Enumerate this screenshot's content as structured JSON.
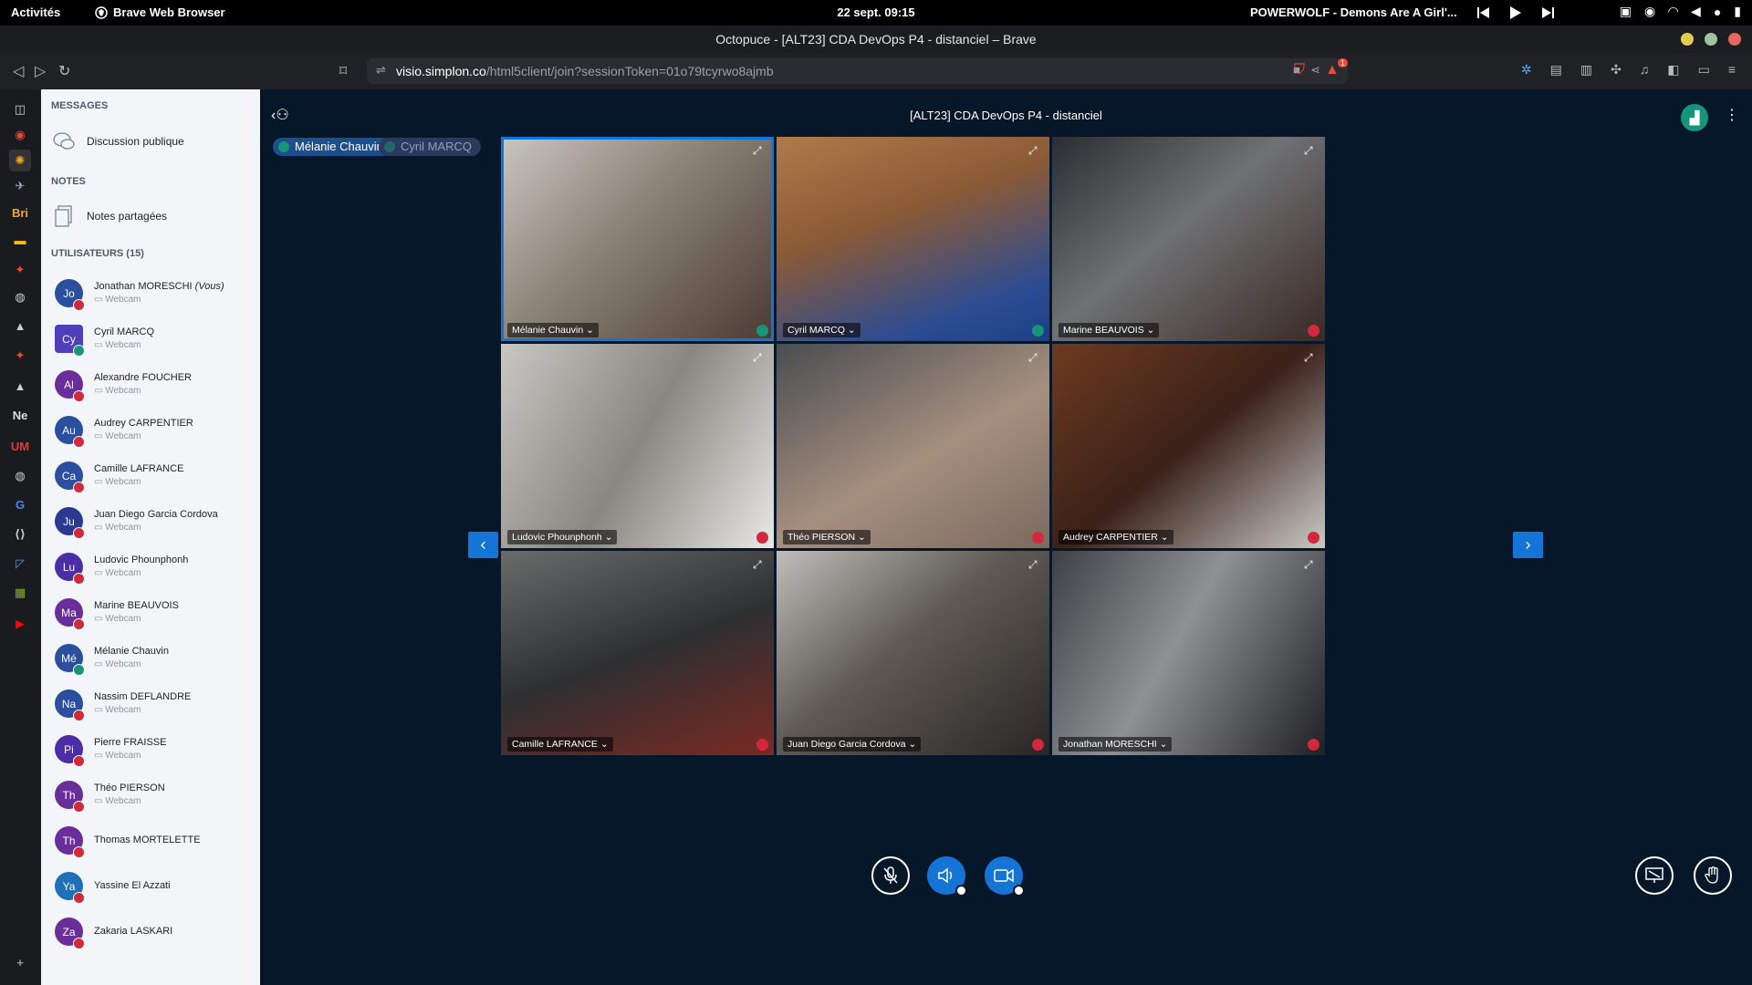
{
  "topbar": {
    "activities": "Activités",
    "app_name": "Brave Web Browser",
    "clock": "22 sept.  09:15",
    "now_playing": "POWERWOLF - Demons Are A Girl'..."
  },
  "browser": {
    "window_title": "Octopuce - [ALT23] CDA DevOps P4 - distanciel – Brave",
    "url_host": "visio.simplon.co",
    "url_path": "/html5client/join?sessionToken=01o79tcyrwo8ajmb",
    "shield_badge": "1"
  },
  "sidebar_brave": {
    "labels": [
      "Bri",
      "Ne",
      "UM"
    ]
  },
  "panel": {
    "messages_title": "MESSAGES",
    "public_chat": "Discussion publique",
    "notes_title": "NOTES",
    "shared_notes": "Notes partagées",
    "users_title": "UTILISATEURS (15)",
    "users": [
      {
        "initials": "Jo",
        "name": "Jonathan MORESCHI",
        "you": "(Vous)",
        "status": "Webcam",
        "color": "#2b4f9e",
        "mic": "muted"
      },
      {
        "initials": "Cy",
        "name": "Cyril MARCQ",
        "you": "",
        "status": "Webcam",
        "color": "#4f3fb8",
        "mic": "talking"
      },
      {
        "initials": "Al",
        "name": "Alexandre FOUCHER",
        "you": "",
        "status": "Webcam",
        "color": "#6a2e9a",
        "mic": "muted"
      },
      {
        "initials": "Au",
        "name": "Audrey CARPENTIER",
        "you": "",
        "status": "Webcam",
        "color": "#2b4f9e",
        "mic": "muted"
      },
      {
        "initials": "Ca",
        "name": "Camille LAFRANCE",
        "you": "",
        "status": "Webcam",
        "color": "#2b4f9e",
        "mic": "muted"
      },
      {
        "initials": "Ju",
        "name": "Juan Diego Garcia Cordova",
        "you": "",
        "status": "Webcam",
        "color": "#2a3a92",
        "mic": "muted"
      },
      {
        "initials": "Lu",
        "name": "Ludovic Phounphonh",
        "you": "",
        "status": "Webcam",
        "color": "#4a2ea5",
        "mic": "muted"
      },
      {
        "initials": "Ma",
        "name": "Marine BEAUVOIS",
        "you": "",
        "status": "Webcam",
        "color": "#6a2e9a",
        "mic": "muted"
      },
      {
        "initials": "Mé",
        "name": "Mélanie Chauvin",
        "you": "",
        "status": "Webcam",
        "color": "#2b4f9e",
        "mic": "talking"
      },
      {
        "initials": "Na",
        "name": "Nassim DEFLANDRE",
        "you": "",
        "status": "Webcam",
        "color": "#2b4f9e",
        "mic": "muted"
      },
      {
        "initials": "Pi",
        "name": "Pierre FRAISSE",
        "you": "",
        "status": "Webcam",
        "color": "#4a2ea5",
        "mic": "muted"
      },
      {
        "initials": "Th",
        "name": "Théo PIERSON",
        "you": "",
        "status": "Webcam",
        "color": "#6a2e9a",
        "mic": "muted"
      },
      {
        "initials": "Th",
        "name": "Thomas MORTELETTE",
        "you": "",
        "status": "",
        "color": "#6a2e9a",
        "mic": "muted"
      },
      {
        "initials": "Ya",
        "name": "Yassine El Azzati",
        "you": "",
        "status": "",
        "color": "#1e70b8",
        "mic": "muted"
      },
      {
        "initials": "Za",
        "name": "Zakaria LASKARI",
        "you": "",
        "status": "",
        "color": "#6a2e9a",
        "mic": "muted"
      }
    ]
  },
  "meeting": {
    "title": "[ALT23] CDA DevOps P4 - distanciel",
    "talkers": [
      {
        "name": "Mélanie Chauvin",
        "state": "active"
      },
      {
        "name": "Cyril MARCQ",
        "state": "idle"
      }
    ],
    "tiles": [
      {
        "name": "Mélanie Chauvin",
        "mic": "talking",
        "active": true,
        "bg": "linear-gradient(135deg,#c9c6c1 0%,#8a8175 45%,#4a3b33 100%)"
      },
      {
        "name": "Cyril MARCQ",
        "mic": "talking",
        "active": false,
        "bg": "linear-gradient(160deg,#b07a4a 0%,#8a5a36 40%,#2d4c92 80%,#1d3e86 100%)"
      },
      {
        "name": "Marine BEAUVOIS",
        "mic": "muted",
        "active": false,
        "bg": "linear-gradient(140deg,#2a2d31 0%,#6f7174 45%,#3a2a24 100%)"
      },
      {
        "name": "Ludovic Phounphonh",
        "mic": "muted",
        "active": false,
        "bg": "linear-gradient(120deg,#c9c7c4 0%,#8a8680 50%,#e9e8e6 100%)"
      },
      {
        "name": "Théo PIERSON",
        "mic": "muted",
        "active": false,
        "bg": "linear-gradient(150deg,#4a4d50 0%,#a58f7f 55%,#7b6a60 100%)"
      },
      {
        "name": "Audrey CARPENTIER",
        "mic": "muted",
        "active": false,
        "bg": "linear-gradient(140deg,#6e3a1f 0%,#3a2119 50%,#c8c9c5 100%)"
      },
      {
        "name": "Camille LAFRANCE",
        "mic": "muted",
        "active": false,
        "bg": "linear-gradient(160deg,#6a6b6b 0%,#2e2f31 50%,#7a2a22 100%)"
      },
      {
        "name": "Juan Diego Garcia Cordova",
        "mic": "muted",
        "active": false,
        "bg": "linear-gradient(140deg,#bfbdba 0%,#5f5a55 45%,#2a2624 100%)"
      },
      {
        "name": "Jonathan MORESCHI",
        "mic": "muted",
        "active": false,
        "bg": "linear-gradient(120deg,#3e4045 0%,#8e9094 45%,#1e2024 100%)"
      }
    ]
  },
  "colors": {
    "primary": "#1475d6",
    "danger": "#d3283c",
    "talking": "#16957b",
    "background": "#06172a"
  }
}
